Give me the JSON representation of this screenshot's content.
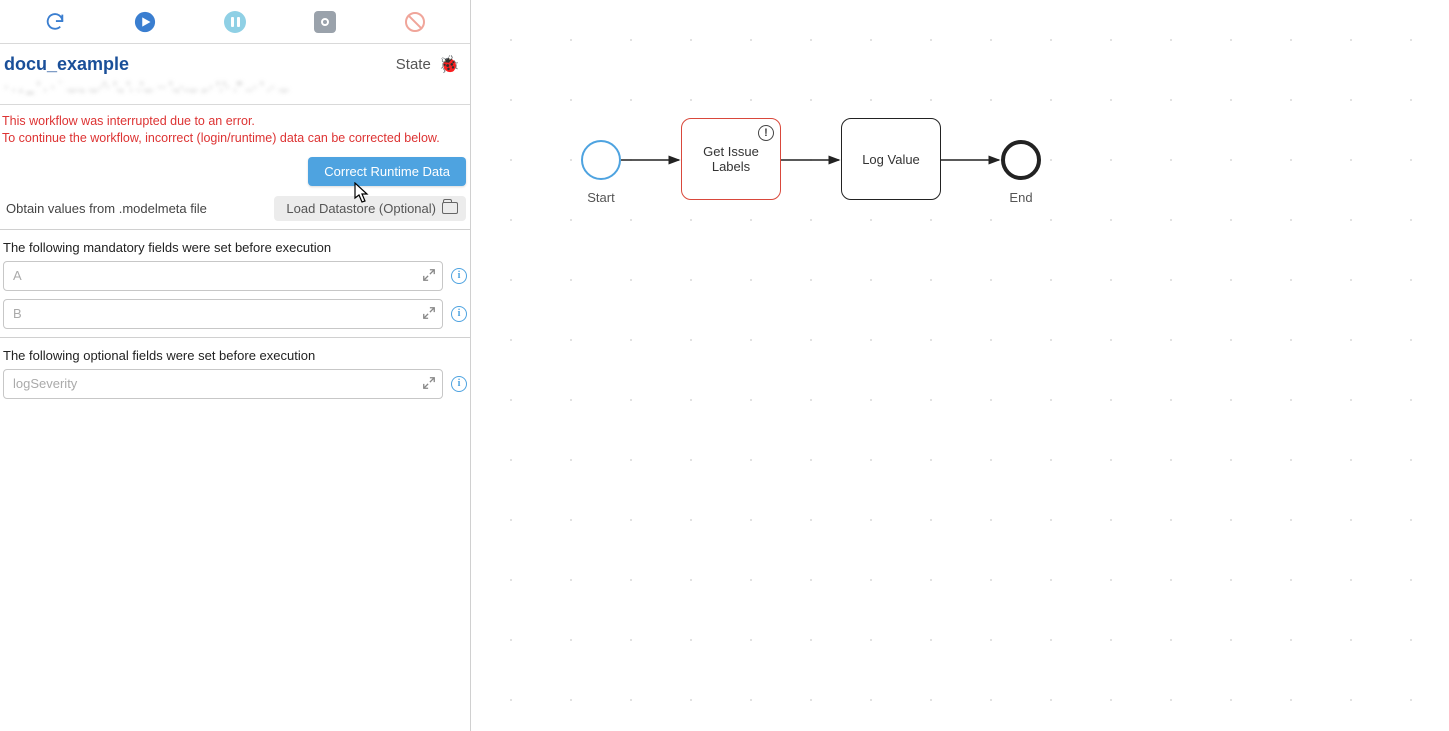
{
  "toolbar": {
    "refresh_tip": "Refresh",
    "play_tip": "Run",
    "pause_tip": "Pause",
    "stop_tip": "Stop",
    "cancel_tip": "Cancel"
  },
  "header": {
    "title": "docu_example",
    "state_label": "State",
    "bug_tip": "Workflow errored"
  },
  "path_blurred": "· . , _ ' . · ˙ .,.., .,.·'·  '.,  '. .'.,. ·· '.,·..,. ,.· '.'·    .'' ..· ' .· .,.",
  "error": {
    "line1": "This workflow was interrupted due to an error.",
    "line2": "To continue the workflow, incorrect (login/runtime) data can be corrected below."
  },
  "buttons": {
    "correct_runtime": "Correct Runtime Data",
    "obtain_label": "Obtain values from .modelmeta file",
    "load_datastore": "Load Datastore (Optional)"
  },
  "sections": {
    "mandatory_heading": "The following mandatory fields were set before execution",
    "optional_heading": "The following optional fields were set before execution"
  },
  "fields": {
    "mandatory": [
      {
        "placeholder": "A"
      },
      {
        "placeholder": "B"
      }
    ],
    "optional": [
      {
        "placeholder": "logSeverity"
      }
    ]
  },
  "diagram": {
    "start_label": "Start",
    "end_label": "End",
    "nodes": [
      {
        "id": "get_issue_labels",
        "label": "Get Issue Labels",
        "error": true,
        "badge": "!"
      },
      {
        "id": "log_value",
        "label": "Log Value",
        "error": false
      }
    ]
  }
}
